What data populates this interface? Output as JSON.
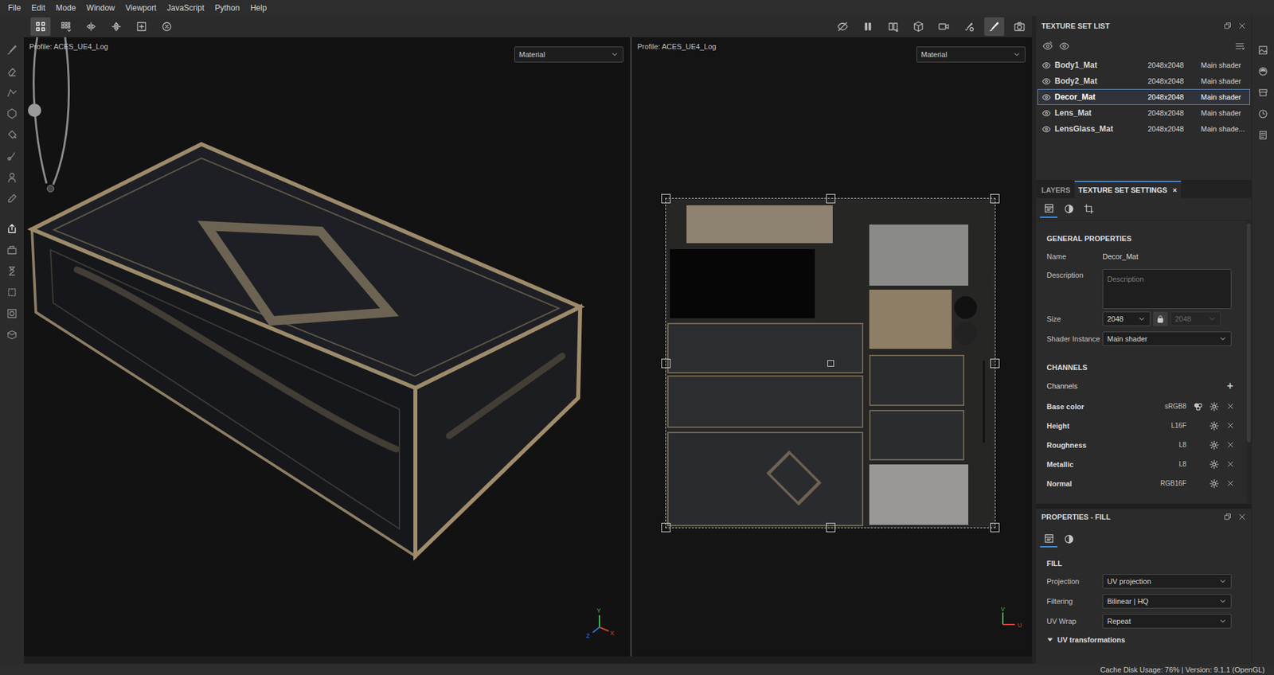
{
  "menu": [
    "File",
    "Edit",
    "Mode",
    "Window",
    "Viewport",
    "JavaScript",
    "Python",
    "Help"
  ],
  "toolbar": {
    "left": [
      {
        "selected": true
      },
      {
        "selected": false
      },
      {
        "selected": false
      },
      {
        "selected": false
      },
      {
        "selected": false
      },
      {
        "selected": false
      }
    ],
    "right": [
      {
        "selected": false
      },
      {
        "selected": false
      },
      {
        "selected": false
      },
      {
        "selected": false
      },
      {
        "selected": false
      },
      {
        "selected": false
      },
      {
        "selected": true
      },
      {
        "selected": false
      }
    ]
  },
  "tools": [
    {
      "selected": false
    },
    {
      "selected": false
    },
    {
      "selected": false
    },
    {
      "selected": false
    },
    {
      "selected": false
    },
    {
      "selected": false
    },
    {
      "selected": false
    },
    {
      "selected": false
    },
    {
      "selected": true
    },
    {
      "selected": false
    },
    {
      "selected": false
    },
    {
      "selected": false
    },
    {
      "selected": false
    },
    {
      "selected": false
    }
  ],
  "viewports": [
    {
      "profile": "Profile: ACES_UE4_Log",
      "mode": "Material",
      "axes": [
        "Y",
        "Z",
        "X"
      ]
    },
    {
      "profile": "Profile: ACES_UE4_Log",
      "mode": "Material",
      "axes": [
        "V",
        "U"
      ]
    }
  ],
  "texture_set_list": {
    "title": "TEXTURE SET LIST",
    "rows": [
      {
        "name": "Body1_Mat",
        "size": "2048x2048",
        "shader": "Main shader",
        "visible": true,
        "selected": false
      },
      {
        "name": "Body2_Mat",
        "size": "2048x2048",
        "shader": "Main shader",
        "visible": true,
        "selected": false
      },
      {
        "name": "Decor_Mat",
        "size": "2048x2048",
        "shader": "Main shader",
        "visible": true,
        "selected": true
      },
      {
        "name": "Lens_Mat",
        "size": "2048x2048",
        "shader": "Main shader",
        "visible": true,
        "selected": false
      },
      {
        "name": "LensGlass_Mat",
        "size": "2048x2048",
        "shader": "Main shade...",
        "visible": true,
        "selected": false
      }
    ]
  },
  "tabs": [
    {
      "label": "LAYERS",
      "selected": false
    },
    {
      "label": "TEXTURE SET SETTINGS",
      "selected": true,
      "close": "×"
    }
  ],
  "settings": {
    "section": "GENERAL PROPERTIES",
    "name_label": "Name",
    "name_value": "Decor_Mat",
    "description_label": "Description",
    "description_placeholder": "Description",
    "size_label": "Size",
    "size_value": "2048",
    "size_linked_value": "2048",
    "size_linked_disabled": true,
    "shader_label": "Shader Instance",
    "shader_value": "Main shader"
  },
  "channels": {
    "section": "CHANNELS",
    "label": "Channels",
    "add": "+",
    "rows": [
      {
        "name": "Base color",
        "format": "sRGB8",
        "mix": true
      },
      {
        "name": "Height",
        "format": "L16F",
        "mix": false
      },
      {
        "name": "Roughness",
        "format": "L8",
        "mix": false
      },
      {
        "name": "Metallic",
        "format": "L8",
        "mix": false
      },
      {
        "name": "Normal",
        "format": "RGB16F",
        "mix": false
      }
    ]
  },
  "properties": {
    "title": "PROPERTIES - FILL",
    "section": "FILL",
    "rows": [
      {
        "label": "Projection",
        "value": "UV projection"
      },
      {
        "label": "Filtering",
        "value": "Bilinear | HQ"
      },
      {
        "label": "UV Wrap",
        "value": "Repeat"
      }
    ],
    "group": {
      "label": "UV transformations",
      "expanded": true
    }
  },
  "status_bar": {
    "text": "Cache Disk Usage: 76% | Version: 9.1.1 (OpenGL)"
  }
}
